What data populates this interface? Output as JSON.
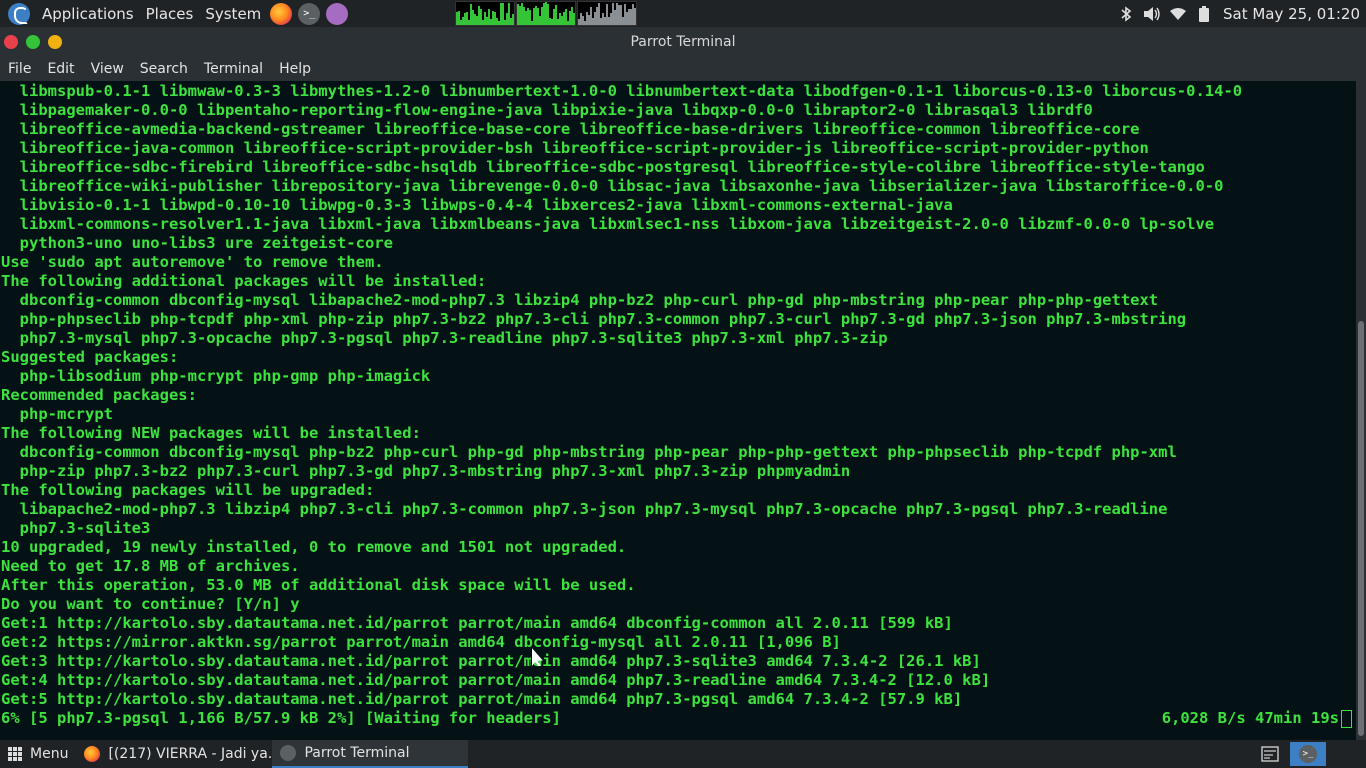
{
  "top_panel": {
    "menus": [
      "Applications",
      "Places",
      "System"
    ],
    "launchers": [
      "firefox-icon",
      "terminal-icon",
      "notes-icon"
    ],
    "tray_icons": [
      "bluetooth-icon",
      "volume-icon",
      "wifi-icon",
      "battery-icon"
    ],
    "clock": "Sat May 25, 01:20"
  },
  "window": {
    "title": "Parrot Terminal"
  },
  "menubar": {
    "items": [
      "File",
      "Edit",
      "View",
      "Search",
      "Terminal",
      "Help"
    ]
  },
  "terminal": {
    "lines": [
      "  libmspub-0.1-1 libmwaw-0.3-3 libmythes-1.2-0 libnumbertext-1.0-0 libnumbertext-data libodfgen-0.1-1 liborcus-0.13-0 liborcus-0.14-0",
      "  libpagemaker-0.0-0 libpentaho-reporting-flow-engine-java libpixie-java libqxp-0.0-0 libraptor2-0 librasqal3 librdf0",
      "  libreoffice-avmedia-backend-gstreamer libreoffice-base-core libreoffice-base-drivers libreoffice-common libreoffice-core",
      "  libreoffice-java-common libreoffice-script-provider-bsh libreoffice-script-provider-js libreoffice-script-provider-python",
      "  libreoffice-sdbc-firebird libreoffice-sdbc-hsqldb libreoffice-sdbc-postgresql libreoffice-style-colibre libreoffice-style-tango",
      "  libreoffice-wiki-publisher librepository-java librevenge-0.0-0 libsac-java libsaxonhe-java libserializer-java libstaroffice-0.0-0",
      "  libvisio-0.1-1 libwpd-0.10-10 libwpg-0.3-3 libwps-0.4-4 libxerces2-java libxml-commons-external-java",
      "  libxml-commons-resolver1.1-java libxml-java libxmlbeans-java libxmlsec1-nss libxom-java libzeitgeist-2.0-0 libzmf-0.0-0 lp-solve",
      "  python3-uno uno-libs3 ure zeitgeist-core",
      "Use 'sudo apt autoremove' to remove them.",
      "The following additional packages will be installed:",
      "  dbconfig-common dbconfig-mysql libapache2-mod-php7.3 libzip4 php-bz2 php-curl php-gd php-mbstring php-pear php-php-gettext",
      "  php-phpseclib php-tcpdf php-xml php-zip php7.3-bz2 php7.3-cli php7.3-common php7.3-curl php7.3-gd php7.3-json php7.3-mbstring",
      "  php7.3-mysql php7.3-opcache php7.3-pgsql php7.3-readline php7.3-sqlite3 php7.3-xml php7.3-zip",
      "Suggested packages:",
      "  php-libsodium php-mcrypt php-gmp php-imagick",
      "Recommended packages:",
      "  php-mcrypt",
      "The following NEW packages will be installed:",
      "  dbconfig-common dbconfig-mysql php-bz2 php-curl php-gd php-mbstring php-pear php-php-gettext php-phpseclib php-tcpdf php-xml",
      "  php-zip php7.3-bz2 php7.3-curl php7.3-gd php7.3-mbstring php7.3-xml php7.3-zip phpmyadmin",
      "The following packages will be upgraded:",
      "  libapache2-mod-php7.3 libzip4 php7.3-cli php7.3-common php7.3-json php7.3-mysql php7.3-opcache php7.3-pgsql php7.3-readline",
      "  php7.3-sqlite3",
      "10 upgraded, 19 newly installed, 0 to remove and 1501 not upgraded.",
      "Need to get 17.8 MB of archives.",
      "After this operation, 53.0 MB of additional disk space will be used.",
      "Do you want to continue? [Y/n] y",
      "Get:1 http://kartolo.sby.datautama.net.id/parrot parrot/main amd64 dbconfig-common all 2.0.11 [599 kB]",
      "Get:2 https://mirror.aktkn.sg/parrot parrot/main amd64 dbconfig-mysql all 2.0.11 [1,096 B]",
      "Get:3 http://kartolo.sby.datautama.net.id/parrot parrot/main amd64 php7.3-sqlite3 amd64 7.3.4-2 [26.1 kB]",
      "Get:4 http://kartolo.sby.datautama.net.id/parrot parrot/main amd64 php7.3-readline amd64 7.3.4-2 [12.0 kB]",
      "Get:5 http://kartolo.sby.datautama.net.id/parrot parrot/main amd64 php7.3-pgsql amd64 7.3.4-2 [57.9 kB]"
    ],
    "status_left": "6% [5 php7.3-pgsql 1,166 B/57.9 kB 2%] [Waiting for headers]",
    "status_right": "6,028 B/s 47min 19s"
  },
  "taskbar": {
    "menu_label": "Menu",
    "tasks": [
      {
        "label": "[(217) VIERRA - Jadi ya...",
        "icon": "firefox-icon",
        "active": false
      },
      {
        "label": "Parrot Terminal",
        "icon": "terminal-icon",
        "active": true
      }
    ]
  },
  "colors": {
    "terminal_text": "#3ee23e",
    "terminal_bg": "#051215",
    "panel_bg": "#1f2326",
    "accent": "#3d7fc4"
  }
}
